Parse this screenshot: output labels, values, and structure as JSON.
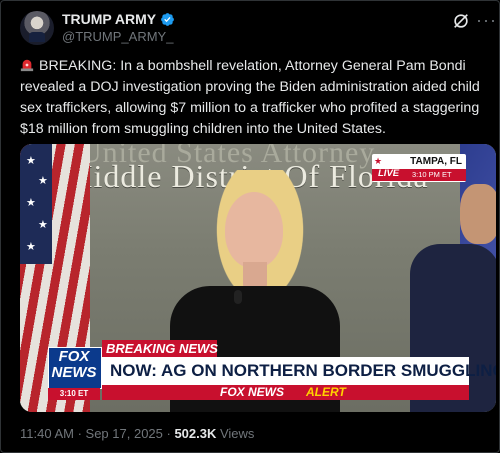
{
  "author": {
    "name": "TRUMP ARMY",
    "handle": "@TRUMP_ARMY_"
  },
  "tweet": {
    "text": "BREAKING: In a bombshell revelation, Attorney General Pam Bondi revealed a DOJ investigation proving the Biden administration aided child sex traffickers, allowing $7 million to a trafficker who profited a staggering $18 million from smuggling children into the United States."
  },
  "media": {
    "wall_line1": "United States Attorney",
    "wall_line2": "Middle District Of Florida",
    "location_city": "TAMPA, FL",
    "location_live": "LIVE",
    "location_time": "3:10 PM ET",
    "breaking_tab": "BREAKING NEWS",
    "headline": "NOW: AG ON NORTHERN BORDER SMUGGLING CRACKDOWN",
    "alert_brand": "FOX NEWS",
    "alert_word": "ALERT",
    "logo_top": "FOX",
    "logo_bottom": "NEWS",
    "logo_time": "3:10 ET"
  },
  "meta": {
    "time": "11:40 AM",
    "sep1": " · ",
    "date": "Sep 17, 2025",
    "sep2": " · ",
    "views_count": "502.3K",
    "views_label": " Views"
  },
  "colors": {
    "accent": "#1d9bf0",
    "fox_red": "#c8102e",
    "fox_blue": "#0b3a8c"
  },
  "icons": {
    "verified": "verified-badge-icon",
    "grok": "grok-icon",
    "more": "more-options-icon",
    "siren": "siren-emoji-icon"
  }
}
